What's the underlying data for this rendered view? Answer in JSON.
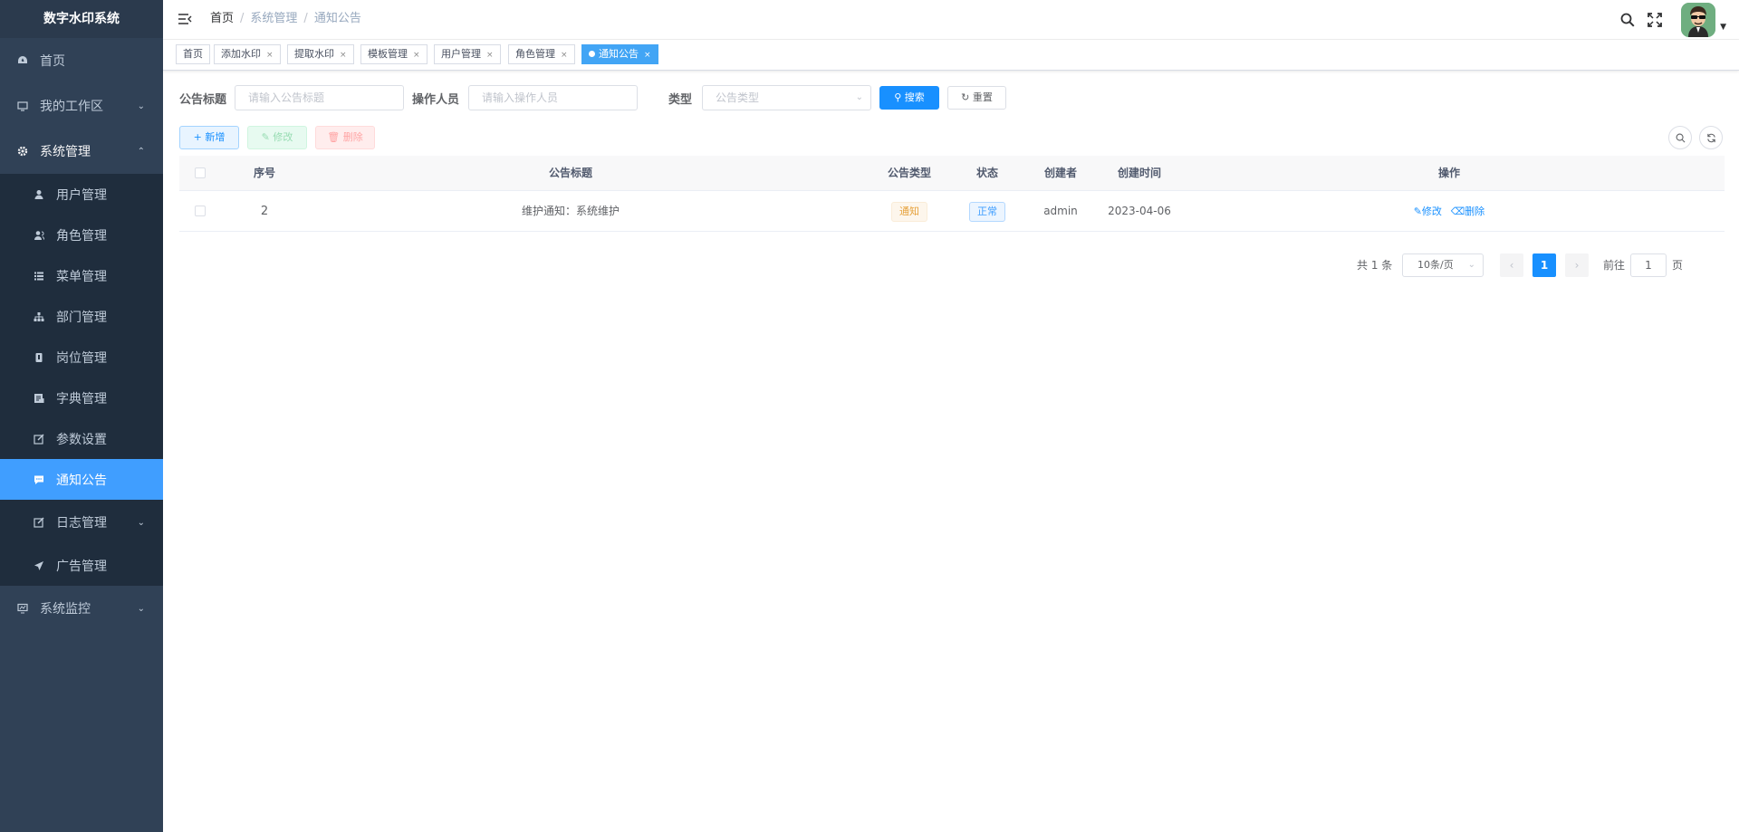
{
  "app": {
    "title": "数字水印系统"
  },
  "sidebar": {
    "items": [
      {
        "label": "首页",
        "icon": "dashboard-icon"
      },
      {
        "label": "我的工作区",
        "icon": "monitor-icon"
      },
      {
        "label": "系统管理",
        "icon": "gear-icon"
      },
      {
        "label": "系统监控",
        "icon": "monitor-chart-icon"
      }
    ],
    "system_sub": [
      {
        "label": "用户管理",
        "icon": "user-icon"
      },
      {
        "label": "角色管理",
        "icon": "users-icon"
      },
      {
        "label": "菜单管理",
        "icon": "tree-table-icon"
      },
      {
        "label": "部门管理",
        "icon": "org-tree-icon"
      },
      {
        "label": "岗位管理",
        "icon": "post-icon"
      },
      {
        "label": "字典管理",
        "icon": "dict-icon"
      },
      {
        "label": "参数设置",
        "icon": "edit-icon"
      },
      {
        "label": "通知公告",
        "icon": "message-icon"
      },
      {
        "label": "日志管理",
        "icon": "log-icon"
      },
      {
        "label": "广告管理",
        "icon": "send-icon"
      }
    ]
  },
  "navbar": {
    "breadcrumb": [
      "首页",
      "系统管理",
      "通知公告"
    ],
    "separator": "/"
  },
  "tags": [
    {
      "label": "首页"
    },
    {
      "label": "添加水印"
    },
    {
      "label": "提取水印"
    },
    {
      "label": "模板管理"
    },
    {
      "label": "用户管理"
    },
    {
      "label": "角色管理"
    },
    {
      "label": "通知公告",
      "active": true
    }
  ],
  "tag_close": "×",
  "filters": {
    "title_label": "公告标题",
    "title_placeholder": "请输入公告标题",
    "operator_label": "操作人员",
    "operator_placeholder": "请输入操作人员",
    "type_label": "类型",
    "type_placeholder": "公告类型",
    "search_button": "搜索",
    "reset_button": "重置"
  },
  "toolbar": {
    "add": "新增",
    "edit": "修改",
    "delete": "删除"
  },
  "table": {
    "columns": [
      "序号",
      "公告标题",
      "公告类型",
      "状态",
      "创建者",
      "创建时间",
      "操作"
    ],
    "rows": [
      {
        "id": "2",
        "title": "维护通知：系统维护",
        "type": "通知",
        "status": "正常",
        "creator": "admin",
        "created": "2023-04-06",
        "action_edit": "修改",
        "action_delete": "删除"
      }
    ]
  },
  "pagination": {
    "total": "共 1 条",
    "page_size": "10条/页",
    "current_page": "1",
    "goto_prefix": "前往",
    "goto_value": "1",
    "goto_suffix": "页"
  },
  "colors": {
    "sidebar_bg": "#304156",
    "submenu_bg": "#1f2d3d",
    "active": "#409eff",
    "primary": "#1890ff"
  }
}
